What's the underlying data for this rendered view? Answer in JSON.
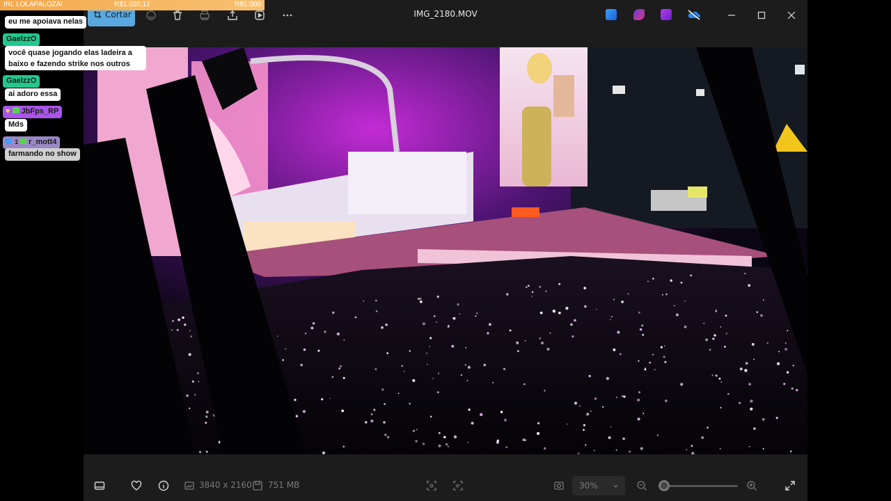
{
  "window": {
    "file_title": "IMG_2180.MOV",
    "crop_label": "Cortar"
  },
  "bottom_bar": {
    "dimensions": "3840 x 2160",
    "file_size": "751 MB",
    "zoom": "30%",
    "zoom_level_fraction": 0.02
  },
  "stream_overlay": {
    "bar_title": "IRL LOLAPALOZA!",
    "bar_amount": "R$1.020,12",
    "bar_goal": "R$1.000",
    "colors": {
      "bar": "#f4a94b",
      "user_green": "#21c98e",
      "user_purple": "#a955e8",
      "user_lilac": "#9a88c6"
    }
  },
  "chat": [
    {
      "text": "eu me apoiava nelas"
    },
    {
      "user": "GaelzzO"
    },
    {
      "text": "você quase jogando elas ladeira a"
    },
    {
      "text": "baixo e fazendo strike nos outros"
    },
    {
      "user": "GaelzzO"
    },
    {
      "text": "ai adoro essa"
    },
    {
      "user": "JbFps_RP"
    },
    {
      "text": "Mds"
    },
    {
      "badge": "1",
      "user": "r_mott4"
    },
    {
      "text": "farmando no show"
    }
  ],
  "icons": [
    "crop-icon",
    "sticker-icon",
    "delete-icon",
    "print-icon",
    "share-icon",
    "slideshow-icon",
    "more-icon",
    "edit-app-icon",
    "clipchamp-icon",
    "video-app-icon",
    "onedrive-icon",
    "minimize-icon",
    "maximize-icon",
    "close-icon",
    "filmstrip-icon",
    "heart-icon",
    "info-icon",
    "zoom-out-icon",
    "zoom-in-icon",
    "fullscreen-icon"
  ]
}
